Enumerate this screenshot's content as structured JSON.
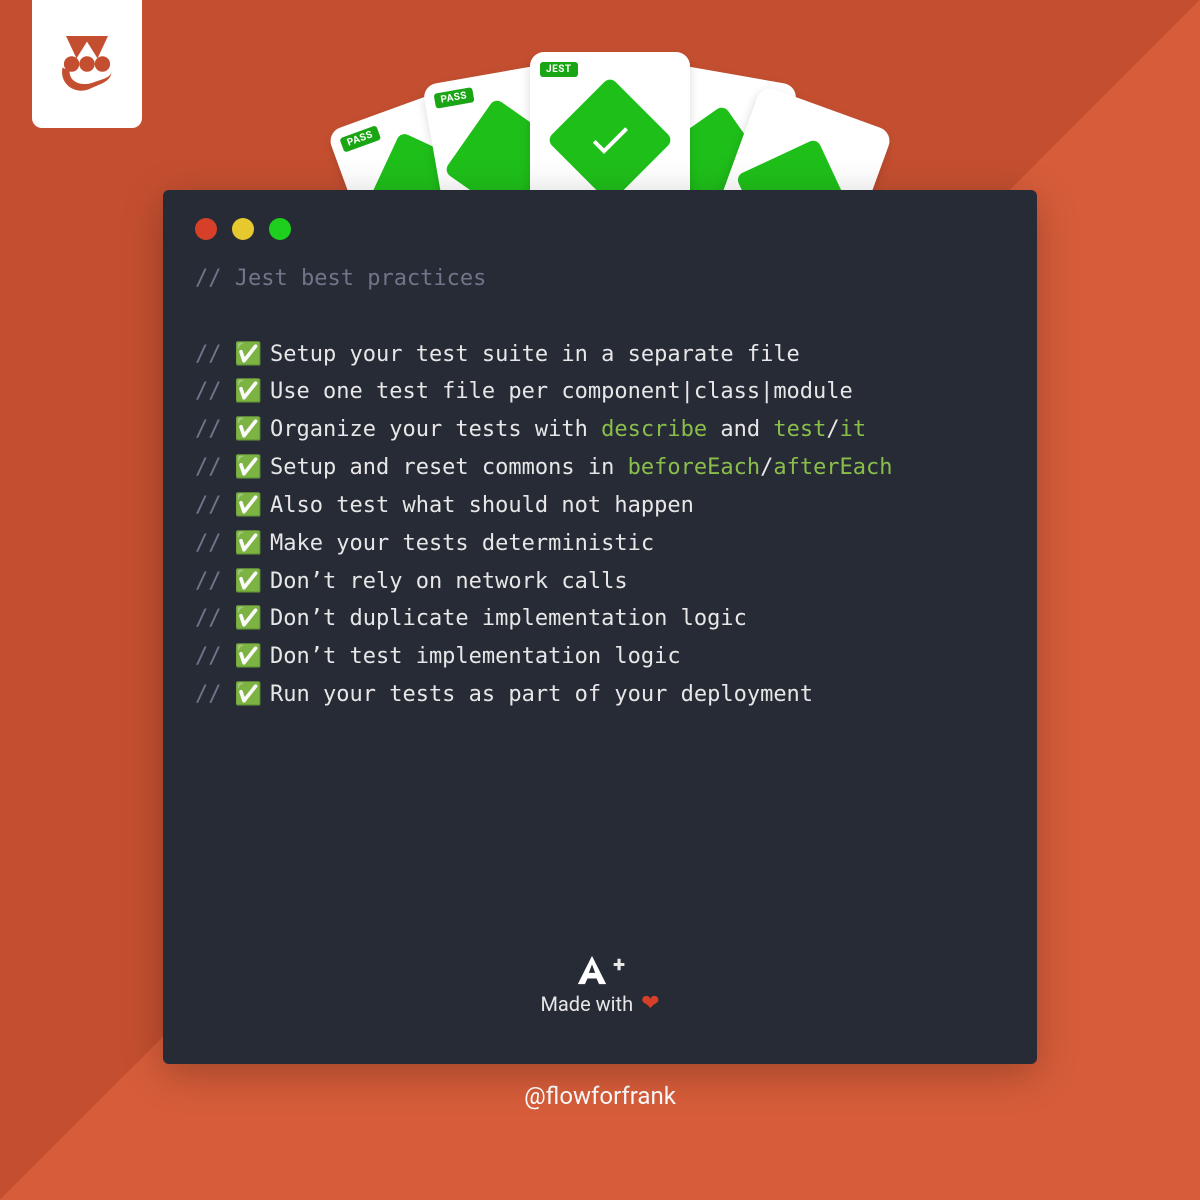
{
  "logo_name": "jest-logo",
  "card_badges": {
    "pass": "PASS",
    "jest": "JEST"
  },
  "title_comment": "Jest best practices",
  "lines": [
    {
      "pre": "Setup your test suite in a separate file"
    },
    {
      "pre": "Use one test file per component|class|module"
    },
    {
      "pre": "Organize your tests with ",
      "kw1": "describe",
      "mid1": " and ",
      "kw2": "test",
      "mid2": "/",
      "kw3": "it"
    },
    {
      "pre": "Setup and reset commons in ",
      "kw1": "beforeEach",
      "mid1": "/",
      "kw2": "afterEach"
    },
    {
      "pre": "Also test what should not happen"
    },
    {
      "pre": "Make your tests deterministic"
    },
    {
      "pre": "Don’t rely on network calls"
    },
    {
      "pre": "Don’t duplicate implementation logic"
    },
    {
      "pre": "Don’t test implementation logic"
    },
    {
      "pre": "Run your tests as part of your deployment"
    }
  ],
  "footer": {
    "brand": "A",
    "plus": "+",
    "made": "Made with"
  },
  "handle": "@flowforfrank",
  "slashes": "//",
  "check": "✅"
}
